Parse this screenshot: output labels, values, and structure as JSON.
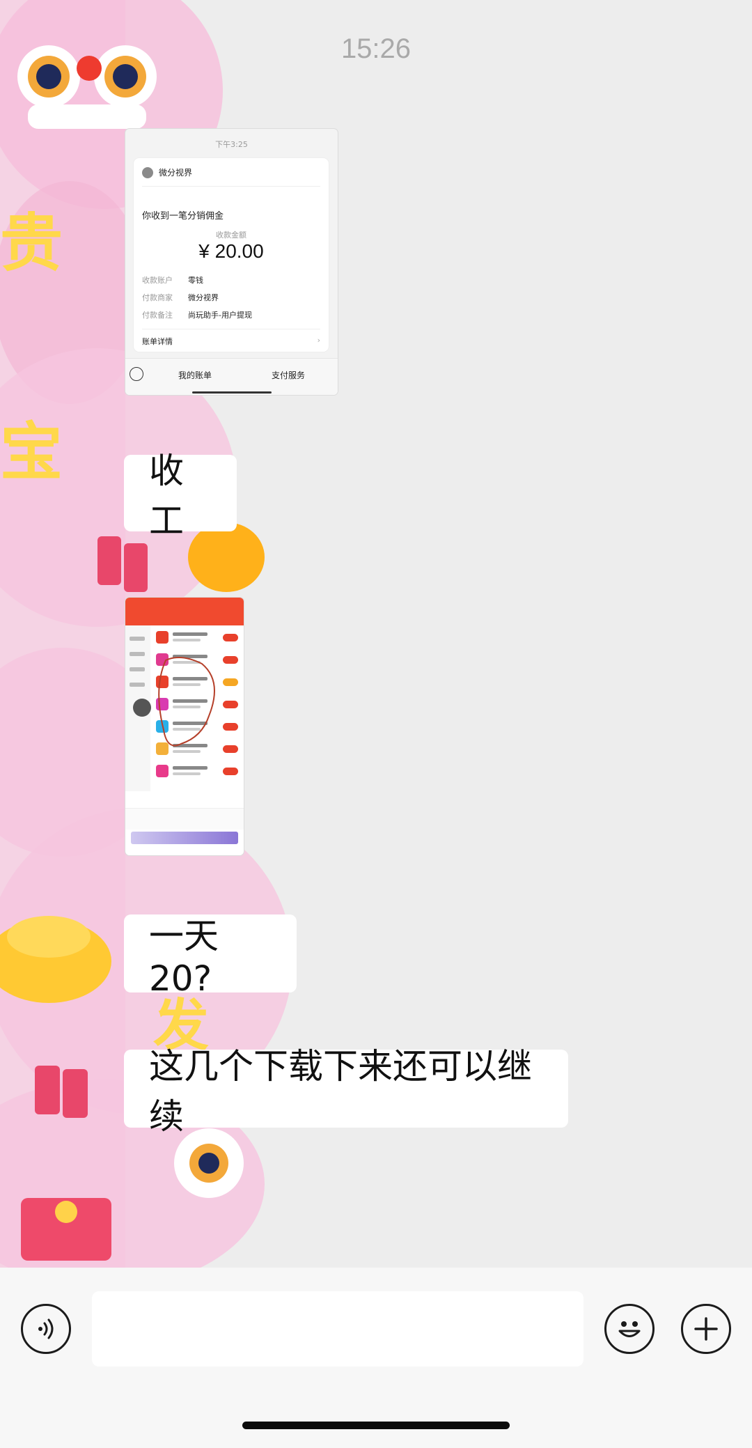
{
  "status": {
    "time": "15:26"
  },
  "messages": [
    {
      "type": "image",
      "receipt": {
        "top_time": "下午3:25",
        "merchant": "微分视界",
        "title": "你收到一笔分销佣金",
        "amount_label": "收款金额",
        "amount": "¥ 20.00",
        "rows": [
          {
            "key": "收款账户",
            "value": "零钱"
          },
          {
            "key": "付款商家",
            "value": "微分视界"
          },
          {
            "key": "付款备注",
            "value": "尚玩助手-用户提现"
          }
        ],
        "detail_label": "账单详情",
        "detail_chevron": "›",
        "bottom_tabs": [
          "我的账单",
          "支付服务"
        ]
      }
    },
    {
      "type": "text",
      "text": "收工"
    },
    {
      "type": "image",
      "description_icon": "app-list-screenshot"
    },
    {
      "type": "text",
      "text": "一天 20?"
    },
    {
      "type": "text",
      "text": "这几个下载下来还可以继续"
    }
  ],
  "input_bar": {
    "voice_icon": "voice-icon",
    "emoji_icon": "emoji-icon",
    "plus_icon": "plus-icon",
    "placeholder": ""
  },
  "colors": {
    "bubble": "#ffffff",
    "background": "#ededed",
    "sticker_pink": "#f6c6df"
  }
}
